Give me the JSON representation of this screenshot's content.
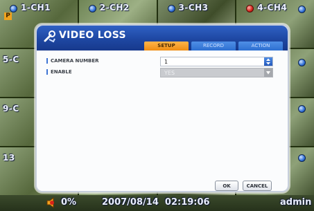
{
  "mosaic": {
    "row1": [
      "1-CH1",
      "2-CH2",
      "3-CH3",
      "4-CH4"
    ],
    "row_labels": [
      "5-C",
      "9-C",
      "13"
    ],
    "p_marker": "P"
  },
  "dialog": {
    "title": "VIDEO LOSS",
    "tabs": [
      "SETUP",
      "RECORD",
      "ACTION"
    ],
    "active_tab": "SETUP",
    "fields": {
      "camera_number": {
        "label": "CAMERA NUMBER",
        "value": "1"
      },
      "enable": {
        "label": "ENABLE",
        "value": "YES",
        "disabled": true
      }
    },
    "ok_label": "OK",
    "cancel_label": "CANCEL"
  },
  "statusbar": {
    "volume": "0%",
    "datetime": "2007/08/14  02:19:06",
    "user": "admin"
  },
  "colors": {
    "header_blue": "#1e47a2",
    "tab_active": "#f08d14",
    "tab_inactive": "#2d6fd1",
    "record_red": "#d8231a"
  }
}
